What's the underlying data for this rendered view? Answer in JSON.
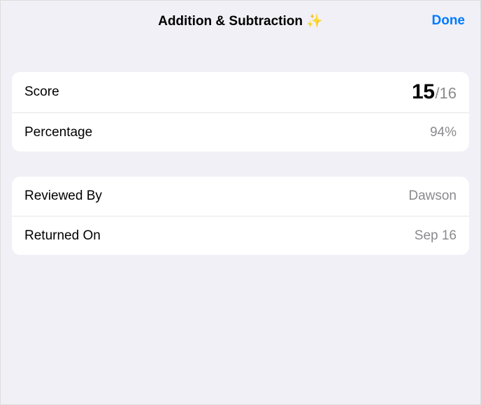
{
  "header": {
    "title": "Addition & Subtraction ✨",
    "done_label": "Done"
  },
  "score_group": {
    "score_label": "Score",
    "score_earned": "15",
    "score_slash": "/",
    "score_total": "16",
    "percentage_label": "Percentage",
    "percentage_value": "94%"
  },
  "review_group": {
    "reviewed_by_label": "Reviewed By",
    "reviewed_by_value": "Dawson",
    "returned_on_label": "Returned On",
    "returned_on_value": "Sep 16"
  }
}
